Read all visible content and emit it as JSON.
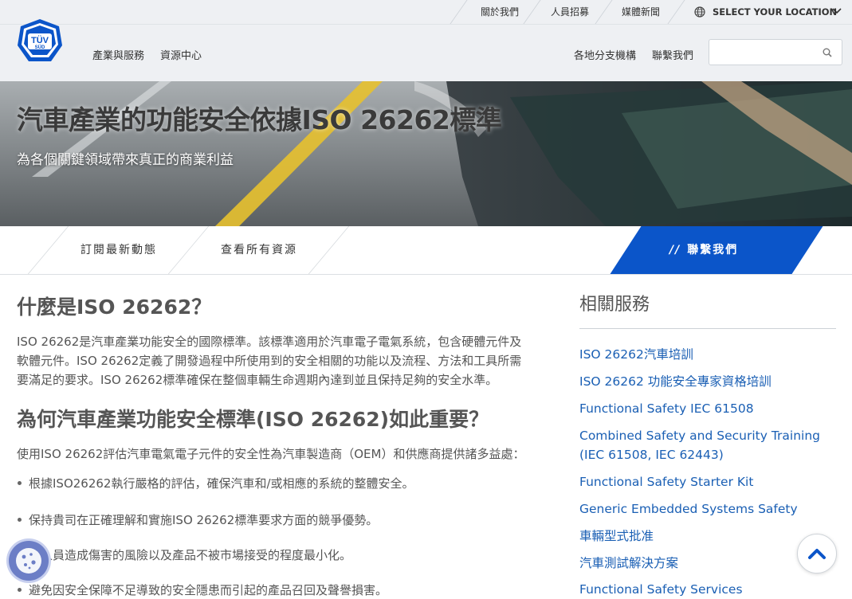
{
  "utility_nav": {
    "items": [
      "關於我們",
      "人員招募",
      "媒體新聞"
    ],
    "location_label": "SELECT YOUR LOCATION"
  },
  "logo": {
    "line1": "TÜV",
    "line2": "SÜD"
  },
  "main_nav": {
    "left": [
      "產業與服務",
      "資源中心"
    ],
    "right": [
      "各地分支機構",
      "聯繫我們"
    ]
  },
  "search": {
    "placeholder": ""
  },
  "hero": {
    "title": "汽車產業的功能安全依據ISO 26262標準",
    "subtitle": "為各個關鍵領域帶來真正的商業利益"
  },
  "actions": {
    "subscribe": "訂閱最新動態",
    "resources": "查看所有資源",
    "contact_icon": "//",
    "contact": "聯繫我們"
  },
  "content": {
    "h1": "什麼是ISO 26262？",
    "p1_lines": [
      "ISO 26262是汽車產業功能安全的國際標準。該標準適用於汽車電子電氣系統，包含硬體元件及",
      "軟體元件。ISO 26262定義了開發過程中所使用到的安全相關的功能以及流程、方法和工具所需",
      "要滿足的要求。ISO 26262標準確保在整個車輛生命週期內達到並且保持足夠的安全水準。"
    ],
    "h2": "為何汽車產業功能安全標準(ISO 26262)如此重要？",
    "p2": "使用ISO 26262評估汽車電氣電子元件的安全性為汽車製造商（OEM）和供應商提供諸多益處：",
    "bullets": [
      "根據ISO26262執行嚴格的評估，確保汽車和/或相應的系統的整體安全。",
      "保持貴司在正確理解和實施ISO 26262標準要求方面的競爭優勢。",
      "對人員造成傷害的風險以及產品不被市場接受的程度最小化。",
      "避免因安全保障不足導致的安全隱患而引起的產品召回及聲譽損害。"
    ]
  },
  "sidebar": {
    "title": "相關服務",
    "links": [
      "ISO 26262汽車培訓",
      "ISO 26262 功能安全專家資格培訓",
      "Functional Safety IEC 61508",
      "Combined Safety and Security Training (IEC 61508, IEC 62443)",
      "Functional Safety Starter Kit",
      "Generic Embedded Systems Safety",
      "車輛型式批准",
      "汽車測試解決方案",
      "Functional Safety Services"
    ]
  },
  "colors": {
    "accent_blue": "#0b55c9",
    "link_blue": "#1a5fb4",
    "header_bg": "#eef0f3"
  }
}
